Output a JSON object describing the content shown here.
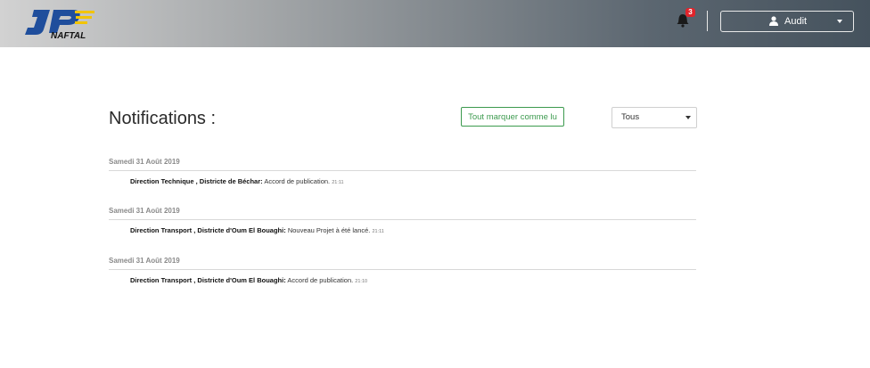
{
  "header": {
    "logo_text": "NAFTAL",
    "notification_count": "3",
    "user_label": "Audit"
  },
  "main": {
    "title": "Notifications :",
    "mark_all_label": "Tout marquer comme lu",
    "filter_value": "Tous"
  },
  "groups": [
    {
      "date": "Samedi 31 Août 2019",
      "notification": {
        "sender": "Direction Technique , Districte de Béchar:",
        "message": " Accord de publication.",
        "time": "21:11"
      }
    },
    {
      "date": "Samedi 31 Août 2019",
      "notification": {
        "sender": "Direction Transport , Districte d'Oum El Bouaghi:",
        "message": " Nouveau Projet à été lancé.",
        "time": "21:11"
      }
    },
    {
      "date": "Samedi 31 Août 2019",
      "notification": {
        "sender": "Direction Transport , Districte d'Oum El Bouaghi:",
        "message": " Accord de publication.",
        "time": "21:10"
      }
    }
  ]
}
